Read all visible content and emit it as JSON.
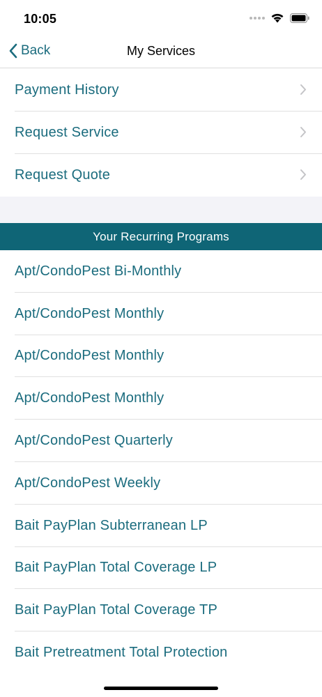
{
  "status_bar": {
    "time": "10:05"
  },
  "nav": {
    "back_label": "Back",
    "title": "My Services"
  },
  "menu": [
    {
      "label": "Payment History"
    },
    {
      "label": "Request Service"
    },
    {
      "label": "Request Quote"
    }
  ],
  "section_header": "Your Recurring Programs",
  "programs": [
    {
      "label": "Apt/CondoPest Bi-Monthly"
    },
    {
      "label": "Apt/CondoPest Monthly"
    },
    {
      "label": "Apt/CondoPest Monthly"
    },
    {
      "label": "Apt/CondoPest Monthly"
    },
    {
      "label": "Apt/CondoPest Quarterly"
    },
    {
      "label": "Apt/CondoPest Weekly"
    },
    {
      "label": "Bait PayPlan Subterranean LP"
    },
    {
      "label": "Bait PayPlan Total Coverage LP"
    },
    {
      "label": "Bait PayPlan Total Coverage TP"
    },
    {
      "label": "Bait Pretreatment Total Protection"
    }
  ],
  "icons": {
    "back": "chevron-left-icon",
    "row_arrow": "chevron-right-icon",
    "wifi": "wifi-icon",
    "battery": "battery-icon",
    "signal": "signal-icon"
  },
  "colors": {
    "accent": "#1b6c7e",
    "section_header_bg": "#0f6576",
    "gap_band": "#f3f3f8"
  }
}
